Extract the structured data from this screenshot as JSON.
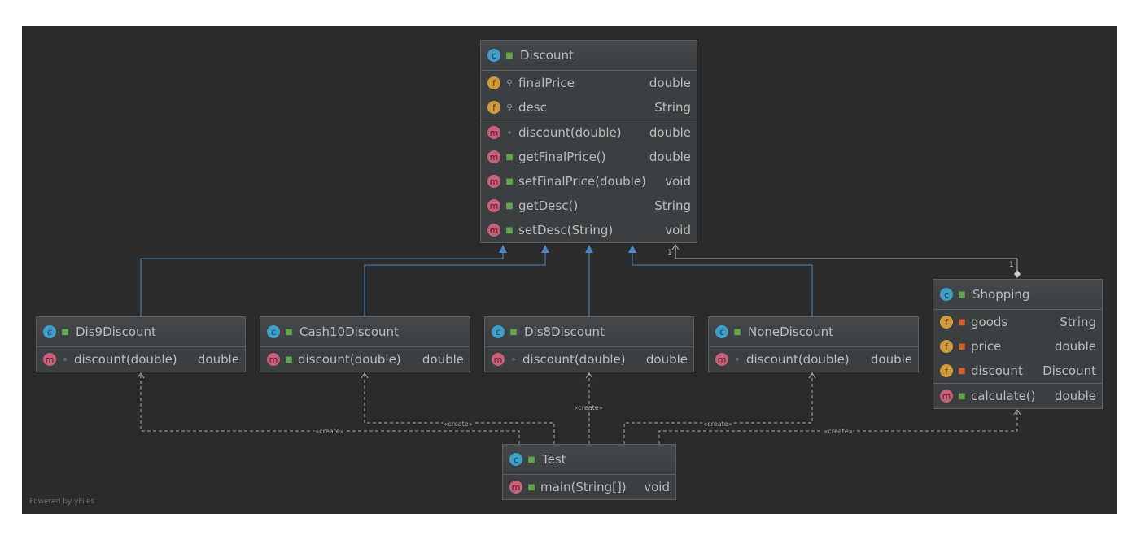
{
  "footer": "Powered by yFiles",
  "colors": {
    "inheritance": "#4a88c7",
    "dependency": "#a9a9a9",
    "association": "#bbbbbb"
  },
  "classes": [
    {
      "id": "Discount",
      "name": "Discount",
      "icon": "abstract-class-icon",
      "vis": "public",
      "sections": [
        [
          {
            "kind": "f",
            "vis": "protected",
            "name": "finalPrice",
            "type": "double"
          },
          {
            "kind": "f",
            "vis": "protected",
            "name": "desc",
            "type": "String"
          }
        ],
        [
          {
            "kind": "m",
            "vis": "package",
            "name": "discount(double)",
            "type": "double"
          },
          {
            "kind": "m",
            "vis": "public",
            "name": "getFinalPrice()",
            "type": "double"
          },
          {
            "kind": "m",
            "vis": "public",
            "name": "setFinalPrice(double)",
            "type": "void"
          },
          {
            "kind": "m",
            "vis": "public",
            "name": "getDesc()",
            "type": "String"
          },
          {
            "kind": "m",
            "vis": "public",
            "name": "setDesc(String)",
            "type": "void"
          }
        ]
      ]
    },
    {
      "id": "Dis9Discount",
      "name": "Dis9Discount",
      "icon": "class-icon",
      "vis": "public",
      "sections": [
        [
          {
            "kind": "m",
            "vis": "package",
            "name": "discount(double)",
            "type": "double"
          }
        ]
      ]
    },
    {
      "id": "Cash10Discount",
      "name": "Cash10Discount",
      "icon": "class-icon",
      "vis": "public",
      "sections": [
        [
          {
            "kind": "m",
            "vis": "public",
            "name": "discount(double)",
            "type": "double"
          }
        ]
      ]
    },
    {
      "id": "Dis8Discount",
      "name": "Dis8Discount",
      "icon": "class-icon",
      "vis": "public",
      "sections": [
        [
          {
            "kind": "m",
            "vis": "package",
            "name": "discount(double)",
            "type": "double"
          }
        ]
      ]
    },
    {
      "id": "NoneDiscount",
      "name": "NoneDiscount",
      "icon": "class-icon",
      "vis": "public",
      "sections": [
        [
          {
            "kind": "m",
            "vis": "package",
            "name": "discount(double)",
            "type": "double"
          }
        ]
      ]
    },
    {
      "id": "Shopping",
      "name": "Shopping",
      "icon": "class-icon",
      "vis": "public",
      "sections": [
        [
          {
            "kind": "f",
            "vis": "private",
            "name": "goods",
            "type": "String"
          },
          {
            "kind": "f",
            "vis": "private",
            "name": "price",
            "type": "double"
          },
          {
            "kind": "f",
            "vis": "private",
            "name": "discount",
            "type": "Discount"
          }
        ],
        [
          {
            "kind": "m",
            "vis": "public",
            "name": "calculate()",
            "type": "double"
          }
        ]
      ]
    },
    {
      "id": "Test",
      "name": "Test",
      "icon": "runnable-class-icon",
      "vis": "public",
      "sections": [
        [
          {
            "kind": "m",
            "vis": "public",
            "name": "main(String[])",
            "type": "void"
          }
        ]
      ]
    }
  ],
  "edges": {
    "inheritance": [
      "Dis9Discount",
      "Cash10Discount",
      "Dis8Discount",
      "NoneDiscount"
    ],
    "association": {
      "from": "Shopping",
      "to": "Discount",
      "from_multiplicity": "1",
      "to_multiplicity": "1"
    },
    "create_label": "«create»",
    "create_targets": [
      "Dis9Discount",
      "Cash10Discount",
      "Dis8Discount",
      "NoneDiscount",
      "Shopping"
    ]
  }
}
